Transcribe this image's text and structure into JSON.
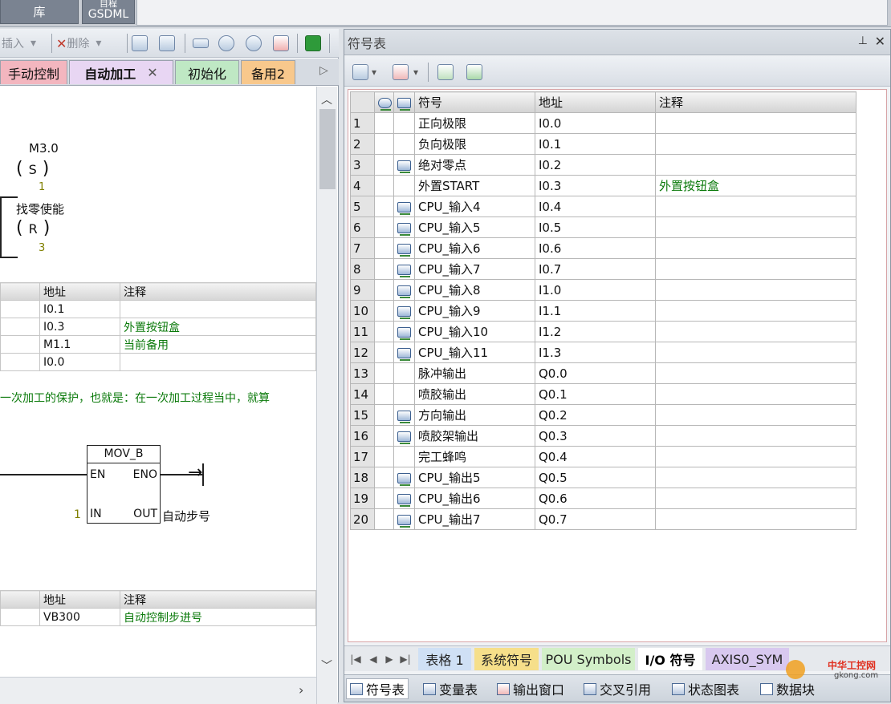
{
  "top": {
    "btn1": "库",
    "btn2": "GSDML",
    "btn2_top": "目程"
  },
  "left_toolbar": {
    "insert": "插入",
    "delete": "删除"
  },
  "left_tabs": [
    "手动控制",
    "自动加工",
    "初始化",
    "备用2"
  ],
  "ladder": {
    "coil1": {
      "symbol": "M3.0",
      "type": "S",
      "n": "1"
    },
    "coil2": {
      "symbol": "找零使能",
      "type": "R",
      "n": "3"
    },
    "comment": "一次加工的保护，也就是：在一次加工过程当中，就算",
    "mov": {
      "name": "MOV_B",
      "en": "EN",
      "eno": "ENO",
      "in": "IN",
      "out": "OUT",
      "in_val": "1",
      "out_val": "自动步号"
    }
  },
  "left_table1": {
    "headers": [
      "地址",
      "注释"
    ],
    "rows": [
      [
        "I0.1",
        ""
      ],
      [
        "I0.3",
        "外置按钮盒"
      ],
      [
        "M1.1",
        "当前备用"
      ],
      [
        "I0.0",
        ""
      ]
    ]
  },
  "left_table2": {
    "headers": [
      "地址",
      "注释"
    ],
    "rows": [
      [
        "VB300",
        "自动控制步进号"
      ]
    ]
  },
  "right": {
    "title": "符号表",
    "headers": [
      "符号",
      "地址",
      "注释"
    ],
    "rows": [
      {
        "n": "1",
        "icon": false,
        "sym": "正向极限",
        "addr": "I0.0",
        "comment": ""
      },
      {
        "n": "2",
        "icon": false,
        "sym": "负向极限",
        "addr": "I0.1",
        "comment": ""
      },
      {
        "n": "3",
        "icon": true,
        "sym": "绝对零点",
        "addr": "I0.2",
        "comment": ""
      },
      {
        "n": "4",
        "icon": false,
        "sym": "外置START",
        "addr": "I0.3",
        "comment": "外置按钮盒"
      },
      {
        "n": "5",
        "icon": true,
        "sym": "CPU_输入4",
        "addr": "I0.4",
        "comment": ""
      },
      {
        "n": "6",
        "icon": true,
        "sym": "CPU_输入5",
        "addr": "I0.5",
        "comment": ""
      },
      {
        "n": "7",
        "icon": true,
        "sym": "CPU_输入6",
        "addr": "I0.6",
        "comment": ""
      },
      {
        "n": "8",
        "icon": true,
        "sym": "CPU_输入7",
        "addr": "I0.7",
        "comment": ""
      },
      {
        "n": "9",
        "icon": true,
        "sym": "CPU_输入8",
        "addr": "I1.0",
        "comment": ""
      },
      {
        "n": "10",
        "icon": true,
        "sym": "CPU_输入9",
        "addr": "I1.1",
        "comment": ""
      },
      {
        "n": "11",
        "icon": true,
        "sym": "CPU_输入10",
        "addr": "I1.2",
        "comment": ""
      },
      {
        "n": "12",
        "icon": true,
        "sym": "CPU_输入11",
        "addr": "I1.3",
        "comment": ""
      },
      {
        "n": "13",
        "icon": false,
        "sym": "脉冲输出",
        "addr": "Q0.0",
        "comment": ""
      },
      {
        "n": "14",
        "icon": false,
        "sym": "喷胶输出",
        "addr": "Q0.1",
        "comment": ""
      },
      {
        "n": "15",
        "icon": true,
        "sym": "方向输出",
        "addr": "Q0.2",
        "comment": ""
      },
      {
        "n": "16",
        "icon": true,
        "sym": "喷胶架输出",
        "addr": "Q0.3",
        "comment": ""
      },
      {
        "n": "17",
        "icon": false,
        "sym": "完工蜂鸣",
        "addr": "Q0.4",
        "comment": ""
      },
      {
        "n": "18",
        "icon": true,
        "sym": "CPU_输出5",
        "addr": "Q0.5",
        "comment": ""
      },
      {
        "n": "19",
        "icon": true,
        "sym": "CPU_输出6",
        "addr": "Q0.6",
        "comment": ""
      },
      {
        "n": "20",
        "icon": true,
        "sym": "CPU_输出7",
        "addr": "Q0.7",
        "comment": ""
      }
    ],
    "sheet_tabs": [
      "表格 1",
      "系统符号",
      "POU Symbols",
      "I/O 符号",
      "AXIS0_SYM"
    ],
    "bottom_tabs": [
      "符号表",
      "变量表",
      "输出窗口",
      "交叉引用",
      "状态图表",
      "数据块"
    ]
  },
  "watermark": {
    "line1": "中华工控网",
    "line2": "gkong.com"
  },
  "colors": {
    "accent_green": "#0b7a0b",
    "tab_pink": "#f3b6bf",
    "tab_active": "#e8d6f3",
    "tab_green": "#bfe8c4",
    "tab_orange": "#f8c88c"
  }
}
